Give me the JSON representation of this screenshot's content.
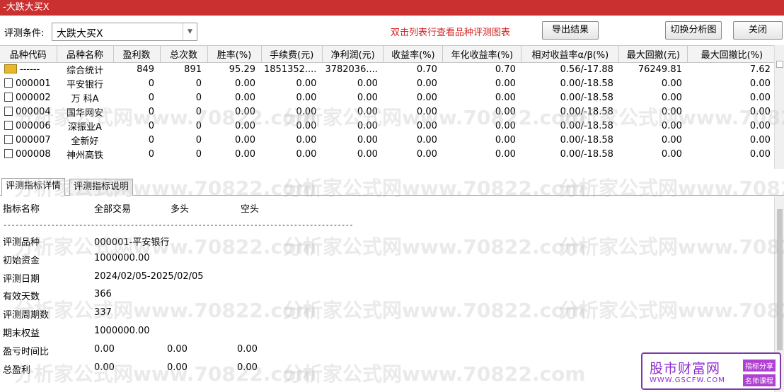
{
  "window": {
    "title": "-大跌大买X",
    "close_glyph": "X"
  },
  "toolbar": {
    "condition_label": "评测条件:",
    "condition_value": "大跌大买X",
    "hint": "双击列表行查看品种评测图表",
    "export_label": "导出结果",
    "switch_label": "切换分析图",
    "close_label": "关闭"
  },
  "table": {
    "columns": [
      "品种代码",
      "品种名称",
      "盈利数",
      "总次数",
      "胜率(%)",
      "手续费(元)",
      "净利润(元)",
      "收益率(%)",
      "年化收益率(%)",
      "相对收益率α/β(%)",
      "最大回撤(元)",
      "最大回撤比(%)"
    ],
    "rows": [
      {
        "code": "------",
        "name": "综合统计",
        "profit": "849",
        "total": "891",
        "win": "95.29",
        "fee": "1851352....",
        "net": "3782036....",
        "ret": "0.70",
        "annual": "0.70",
        "rel": "0.56/-17.88",
        "dd": "76249.81",
        "ddr": "7.62",
        "icon": "folder"
      },
      {
        "code": "000001",
        "name": "平安银行",
        "profit": "0",
        "total": "0",
        "win": "0.00",
        "fee": "0.00",
        "net": "0.00",
        "ret": "0.00",
        "annual": "0.00",
        "rel": "0.00/-18.58",
        "dd": "0.00",
        "ddr": "0.00",
        "icon": "file"
      },
      {
        "code": "000002",
        "name": "万 科A",
        "profit": "0",
        "total": "0",
        "win": "0.00",
        "fee": "0.00",
        "net": "0.00",
        "ret": "0.00",
        "annual": "0.00",
        "rel": "0.00/-18.58",
        "dd": "0.00",
        "ddr": "0.00",
        "icon": "file"
      },
      {
        "code": "000004",
        "name": "国华网安",
        "profit": "0",
        "total": "0",
        "win": "0.00",
        "fee": "0.00",
        "net": "0.00",
        "ret": "0.00",
        "annual": "0.00",
        "rel": "0.00/-18.58",
        "dd": "0.00",
        "ddr": "0.00",
        "icon": "file"
      },
      {
        "code": "000006",
        "name": "深振业A",
        "profit": "0",
        "total": "0",
        "win": "0.00",
        "fee": "0.00",
        "net": "0.00",
        "ret": "0.00",
        "annual": "0.00",
        "rel": "0.00/-18.58",
        "dd": "0.00",
        "ddr": "0.00",
        "icon": "file"
      },
      {
        "code": "000007",
        "name": "全新好",
        "profit": "0",
        "total": "0",
        "win": "0.00",
        "fee": "0.00",
        "net": "0.00",
        "ret": "0.00",
        "annual": "0.00",
        "rel": "0.00/-18.58",
        "dd": "0.00",
        "ddr": "0.00",
        "icon": "file"
      },
      {
        "code": "000008",
        "name": "神州高铁",
        "profit": "0",
        "total": "0",
        "win": "0.00",
        "fee": "0.00",
        "net": "0.00",
        "ret": "0.00",
        "annual": "0.00",
        "rel": "0.00/-18.58",
        "dd": "0.00",
        "ddr": "0.00",
        "icon": "file"
      }
    ]
  },
  "tabs": [
    "评测指标详情",
    "评测指标说明"
  ],
  "detail": {
    "headers": [
      "指标名称",
      "全部交易",
      "多头",
      "空头"
    ],
    "divider": "----------------------------------------------------------------------------------------",
    "rows": [
      {
        "label": "评测品种",
        "v1": "000001-平安银行",
        "v2": "",
        "v3": ""
      },
      {
        "label": "初始资金",
        "v1": "1000000.00",
        "v2": "",
        "v3": ""
      },
      {
        "label": "评测日期",
        "v1": "2024/02/05-2025/02/05",
        "v2": "",
        "v3": ""
      },
      {
        "label": "有效天数",
        "v1": "366",
        "v2": "",
        "v3": ""
      },
      {
        "label": "评测周期数",
        "v1": "337",
        "v2": "",
        "v3": ""
      },
      {
        "label": "期末权益",
        "v1": "1000000.00",
        "v2": "",
        "v3": ""
      },
      {
        "label": "盈亏时间比",
        "v1": "0.00",
        "v2": "0.00",
        "v3": "0.00"
      },
      {
        "label": "总盈利",
        "v1": "0.00",
        "v2": "0.00",
        "v3": "0.00"
      }
    ]
  },
  "watermark": "分析家公式网www.70822.com",
  "logo": {
    "name": "股市财富网",
    "url": "WWW.GSCFW.COM",
    "tag1": "指标分享",
    "tag2": "名师课程"
  },
  "colors": {
    "titlebar": "#c9302f",
    "hint": "#d42020",
    "logo": "#8e2bd0"
  }
}
